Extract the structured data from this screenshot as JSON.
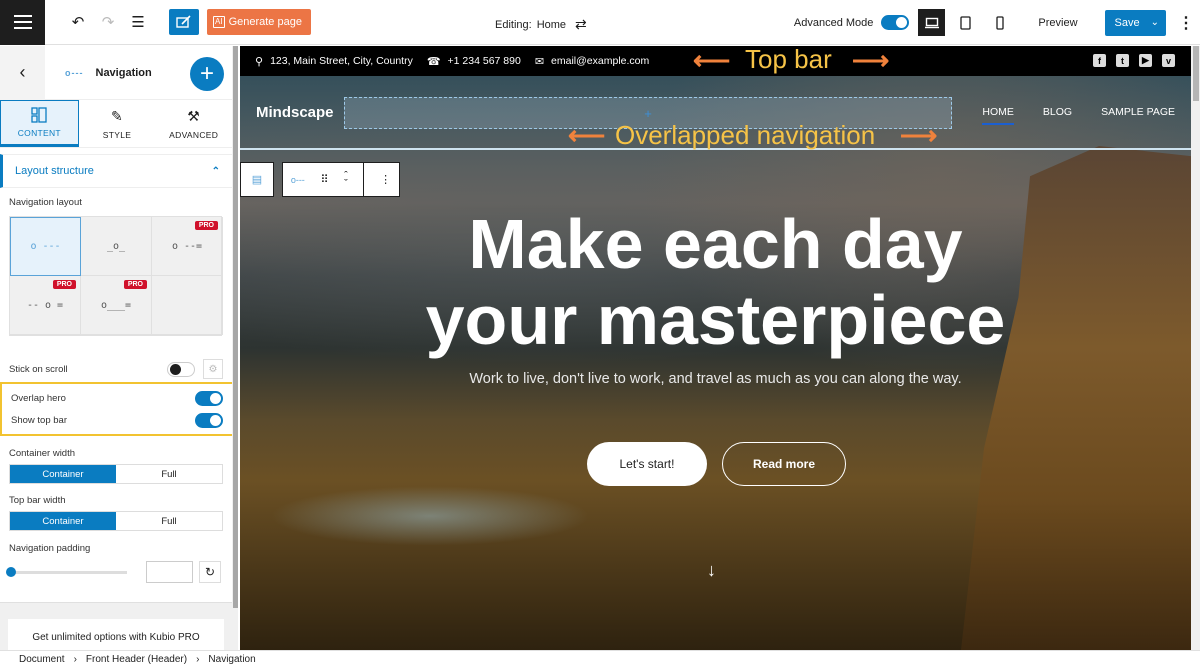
{
  "topbar": {
    "generate_label": "Generate page",
    "ai_badge": "AI",
    "editing_prefix": "Editing:",
    "editing_page": "Home",
    "advanced_mode_label": "Advanced Mode",
    "advanced_mode_on": true,
    "preview_label": "Preview",
    "save_label": "Save",
    "active_device": "desktop"
  },
  "sidebar": {
    "block_title": "Navigation",
    "tabs": [
      {
        "label": "CONTENT",
        "active": true
      },
      {
        "label": "STYLE",
        "active": false
      },
      {
        "label": "ADVANCED",
        "active": false
      }
    ],
    "section_title": "Layout structure",
    "navigation_layout_label": "Navigation layout",
    "layouts": [
      {
        "glyph": "o ---",
        "pro": false,
        "selected": true
      },
      {
        "glyph": "_o_",
        "pro": false,
        "selected": false
      },
      {
        "glyph": "o --=",
        "pro": true,
        "selected": false
      },
      {
        "glyph": "-- o =",
        "pro": true,
        "selected": false
      },
      {
        "glyph": "o___=",
        "pro": true,
        "selected": false
      },
      {
        "glyph": "",
        "pro": false,
        "selected": false
      }
    ],
    "pro_badge": "PRO",
    "stick_on_scroll_label": "Stick on scroll",
    "stick_on_scroll": false,
    "overlap_hero_label": "Overlap hero",
    "overlap_hero": true,
    "show_top_bar_label": "Show top bar",
    "show_top_bar": true,
    "container_width_label": "Container width",
    "container_width_options": [
      "Container",
      "Full"
    ],
    "container_width_selected": "Container",
    "top_bar_width_label": "Top bar width",
    "top_bar_width_options": [
      "Container",
      "Full"
    ],
    "top_bar_width_selected": "Container",
    "navigation_padding_label": "Navigation padding",
    "navigation_padding_value": "",
    "navigation_padding_slider": 0,
    "pro_promo": "Get unlimited options with Kubio PRO"
  },
  "site": {
    "topbar": {
      "address": "123, Main Street, City, Country",
      "phone": "+1 234 567 890",
      "email": "email@example.com",
      "social": [
        "facebook",
        "twitter",
        "youtube",
        "vimeo"
      ]
    },
    "brand": "Mindscape",
    "placeholder_plus": "+",
    "menu": [
      {
        "label": "HOME",
        "current": true
      },
      {
        "label": "BLOG",
        "current": false
      },
      {
        "label": "SAMPLE PAGE",
        "current": false
      }
    ],
    "hero": {
      "title_line1": "Make each day",
      "title_line2": "your masterpiece",
      "subtitle": "Work to live, don't live to work, and travel as much as you can along the way.",
      "primary_button": "Let's start!",
      "secondary_button": "Read more"
    }
  },
  "annotations": {
    "top_bar": "Top bar",
    "overlapped_navigation": "Overlapped navigation",
    "accent_color": "#f6c347",
    "arrow_color": "#f0823c"
  },
  "breadcrumb": [
    "Document",
    "Front Header (Header)",
    "Navigation"
  ],
  "colors": {
    "primary": "#0a7cc1",
    "generate": "#ec7545",
    "pro_badge": "#d0112b",
    "highlight": "#f2c330"
  }
}
